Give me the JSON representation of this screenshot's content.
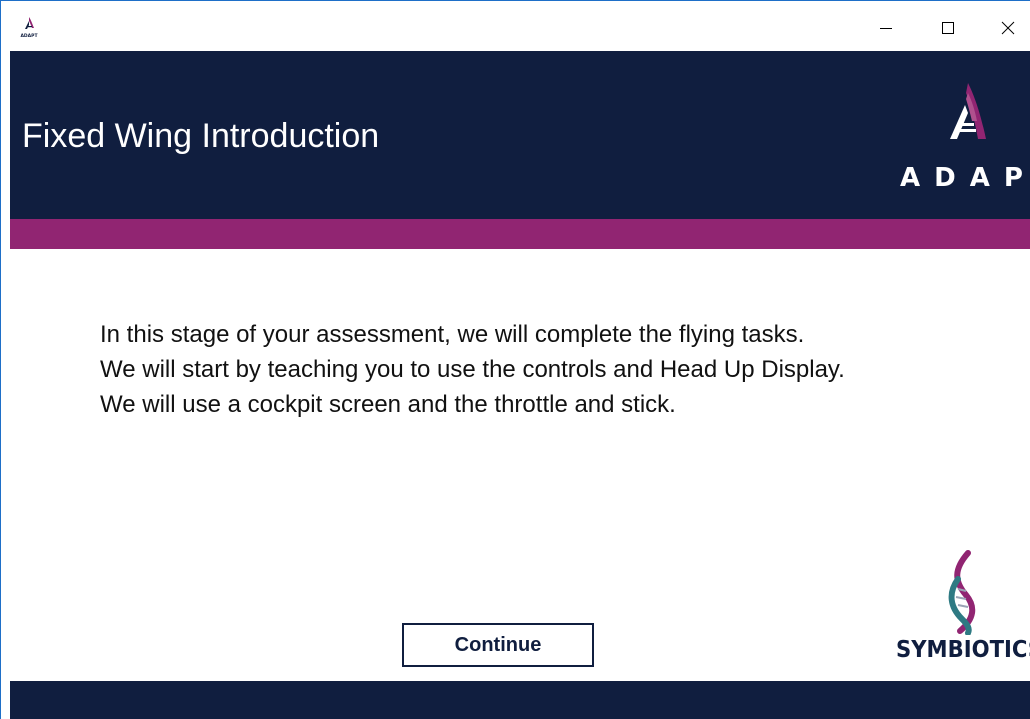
{
  "titlebar": {
    "icon": "adapt-app-icon",
    "app_icon_text": "ADAPT",
    "controls": {
      "minimize": "minimize-icon",
      "maximize": "maximize-icon",
      "close": "close-icon"
    }
  },
  "header": {
    "title": "Fixed Wing Introduction",
    "logo_text": "ADAPT"
  },
  "content": {
    "intro_lines": [
      "In this stage of your assessment, we will complete the flying tasks.",
      "We will start by teaching you to use the controls and Head Up Display.",
      "We will use a cockpit screen and the throttle and stick."
    ],
    "continue_label": "Continue",
    "partner_logo_text": "SYMBIOTICS"
  },
  "colors": {
    "navy": "#101e3f",
    "accent": "#912572",
    "teal": "#2e7a83",
    "window_border": "#1e6fc8"
  }
}
